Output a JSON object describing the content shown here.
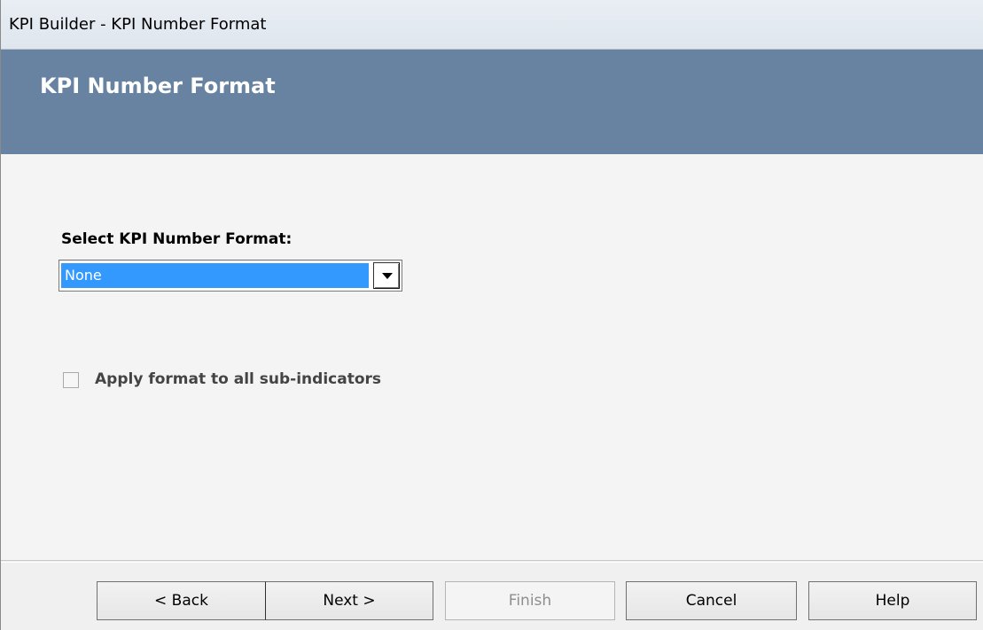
{
  "window": {
    "title": "KPI Builder - KPI Number Format"
  },
  "banner": {
    "title": "KPI Number Format"
  },
  "form": {
    "format_label": "Select KPI Number Format:",
    "format_selected": "None",
    "apply_all_label": "Apply format to all sub-indicators",
    "apply_all_checked": false
  },
  "buttons": {
    "back": "< Back",
    "next": "Next >",
    "finish": "Finish",
    "cancel": "Cancel",
    "help": "Help"
  },
  "colors": {
    "banner": "#6882a1",
    "selection": "#3399ff"
  }
}
